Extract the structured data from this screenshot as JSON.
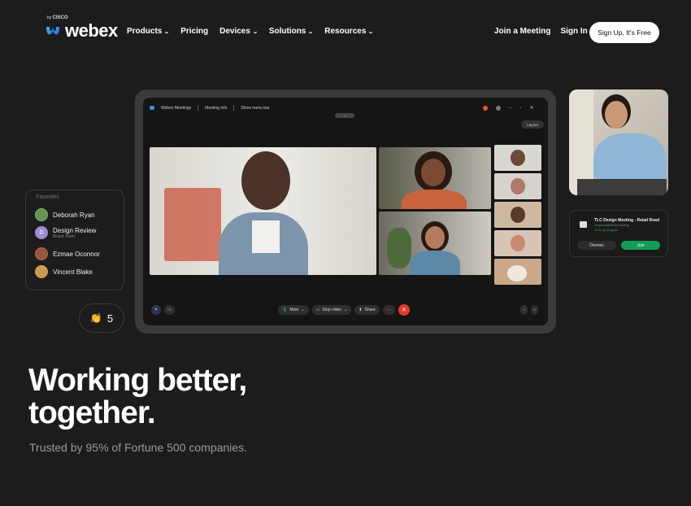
{
  "brand": {
    "name": "webex",
    "by": "by",
    "company": "CISCO"
  },
  "nav": {
    "items": [
      {
        "label": "Products",
        "dropdown": true
      },
      {
        "label": "Pricing",
        "dropdown": false
      },
      {
        "label": "Devices",
        "dropdown": true
      },
      {
        "label": "Solutions",
        "dropdown": true
      },
      {
        "label": "Resources",
        "dropdown": true
      }
    ],
    "join": "Join a Meeting",
    "signin": "Sign In",
    "signup": "Sign Up, It's Free"
  },
  "meeting_window": {
    "app_name": "Webex Meetings",
    "meeting_info": "Meeting info",
    "menu_bar": "Show menu bar",
    "layout": "Layout",
    "controls": {
      "mute": "Mute",
      "stop_video": "Stop video",
      "share": "Share",
      "more": "···"
    }
  },
  "favorites": {
    "title": "Favorites",
    "items": [
      {
        "name": "Deborah Ryan",
        "sub": "",
        "initial": "",
        "color": "#6b8e5a"
      },
      {
        "name": "Design Review",
        "sub": "Brand Team",
        "initial": "D",
        "color": "#9b8bd0"
      },
      {
        "name": "Ezmae Oconnor",
        "sub": "",
        "initial": "",
        "color": "#8a5a4a"
      },
      {
        "name": "Vincent Blake",
        "sub": "",
        "initial": "",
        "color": "#c89a5a"
      }
    ]
  },
  "reaction": {
    "emoji": "👏",
    "count": "5"
  },
  "meeting_card": {
    "title": "TLC Design Meeting - Reiad Road",
    "subtitle": "Jessica started the meeting",
    "status": "10:01 Up Progress",
    "dismiss": "Dismiss",
    "join": "Join"
  },
  "hero": {
    "headline_1": "Working better,",
    "headline_2": "together.",
    "subline": "Trusted by 95% of Fortune 500 companies."
  },
  "colors": {
    "background": "#1c1c1c",
    "accent_green": "#0f9d58",
    "end_red": "#e43a2a"
  }
}
